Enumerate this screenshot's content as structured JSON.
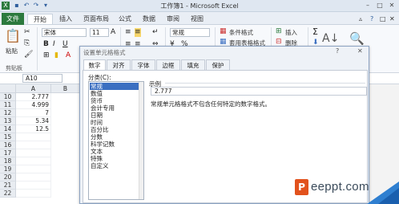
{
  "app": {
    "title": "工作簿1 - Microsoft Excel",
    "icon": "excel-icon",
    "window_buttons": [
      "–",
      "□",
      "✕"
    ]
  },
  "tabs": [
    "文件",
    "开始",
    "插入",
    "页面布局",
    "公式",
    "数据",
    "审阅",
    "视图"
  ],
  "ribbon": {
    "paste_label": "粘贴",
    "clipboard_label": "剪贴板",
    "font_name": "宋体",
    "font_size": "11",
    "number_format": "常规",
    "conditional_format": "条件格式",
    "table_format": "套用表格格式",
    "insert_label": "插入",
    "delete_label": "删除",
    "accent_file_tab": "#2c7a3e"
  },
  "formula_bar": {
    "name_box": "A10"
  },
  "grid": {
    "columns": [
      "A",
      "B"
    ],
    "rows": [
      {
        "row": "10",
        "a": "2.777"
      },
      {
        "row": "11",
        "a": "4.999"
      },
      {
        "row": "12",
        "a": "7"
      },
      {
        "row": "13",
        "a": "5.34"
      },
      {
        "row": "14",
        "a": "12.5"
      },
      {
        "row": "15",
        "a": ""
      },
      {
        "row": "16",
        "a": ""
      },
      {
        "row": "17",
        "a": ""
      },
      {
        "row": "18",
        "a": ""
      },
      {
        "row": "19",
        "a": ""
      },
      {
        "row": "20",
        "a": ""
      },
      {
        "row": "21",
        "a": ""
      },
      {
        "row": "22",
        "a": ""
      }
    ]
  },
  "dialog": {
    "title": "设置单元格格式",
    "help": "?",
    "close": "✕",
    "tabs": [
      "数字",
      "对齐",
      "字体",
      "边框",
      "填充",
      "保护"
    ],
    "category_label": "分类(C):",
    "categories": [
      "常规",
      "数值",
      "货币",
      "会计专用",
      "日期",
      "时间",
      "百分比",
      "分数",
      "科学记数",
      "文本",
      "特殊",
      "自定义"
    ],
    "selected_category": "常规",
    "sample_label": "示例",
    "sample_value": "2.777",
    "description": "常规单元格格式不包含任何特定的数字格式。"
  },
  "watermark": {
    "logo_letter": "P",
    "text": "eeppt.com"
  }
}
